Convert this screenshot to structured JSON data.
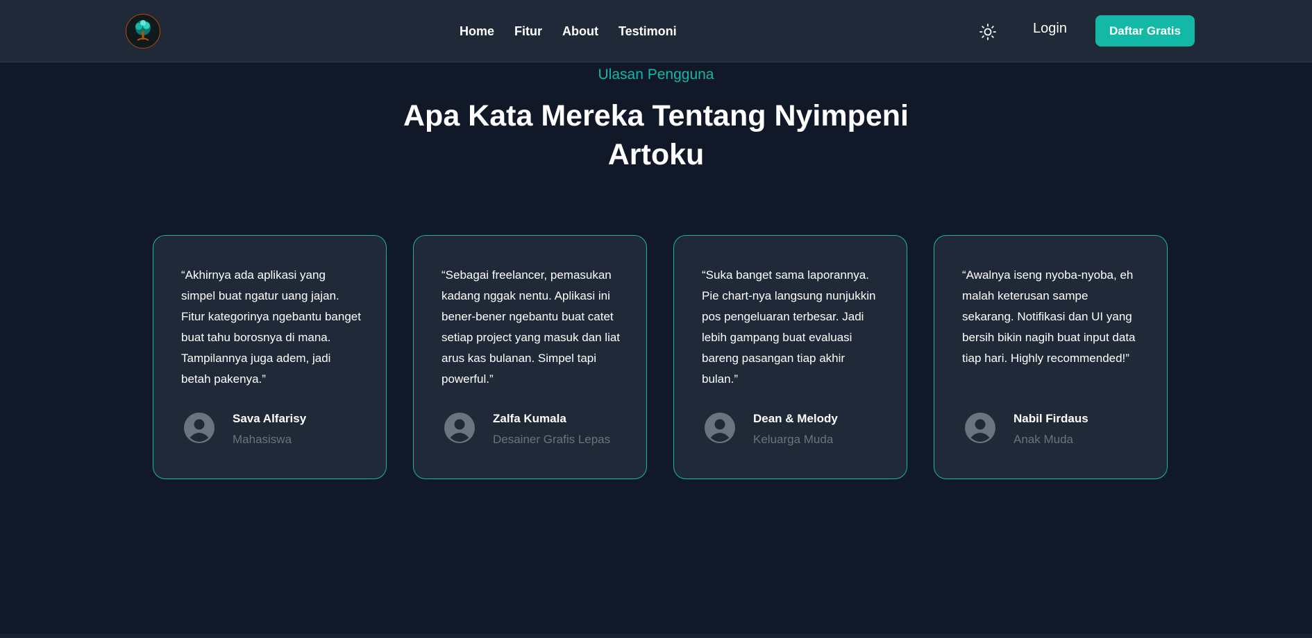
{
  "nav": {
    "links": [
      "Home",
      "Fitur",
      "About",
      "Testimoni"
    ],
    "login": "Login",
    "signup": "Daftar Gratis"
  },
  "section": {
    "eyebrow": "Ulasan Pengguna",
    "title": "Apa Kata Mereka Tentang Nyimpeni Artoku"
  },
  "testimonials": [
    {
      "quote": "“Akhirnya ada aplikasi yang simpel buat ngatur uang jajan. Fitur kategorinya ngebantu banget buat tahu borosnya di mana. Tampilannya juga adem, jadi betah pakenya.”",
      "name": "Sava Alfarisy",
      "role": "Mahasiswa"
    },
    {
      "quote": "“Sebagai freelancer, pemasukan kadang nggak nentu. Aplikasi ini bener-bener ngebantu buat catet setiap project yang masuk dan liat arus kas bulanan. Simpel tapi powerful.”",
      "name": "Zalfa Kumala",
      "role": "Desainer Grafis Lepas"
    },
    {
      "quote": "“Suka banget sama laporannya. Pie chart-nya langsung nunjukkin pos pengeluaran terbesar. Jadi lebih gampang buat evaluasi bareng pasangan tiap akhir bulan.”",
      "name": "Dean & Melody",
      "role": "Keluarga Muda"
    },
    {
      "quote": "“Awalnya iseng nyoba-nyoba, eh malah keterusan sampe sekarang. Notifikasi dan UI yang bersih bikin nagih buat input data tiap hari. Highly recommended!”",
      "name": "Nabil Firdaus",
      "role": "Anak Muda"
    }
  ],
  "colors": {
    "accent": "#14b8a6",
    "background": "#111827",
    "surface": "#1f2937",
    "muted": "#6b7280"
  },
  "icons": {
    "logo": "tree-logo-icon",
    "theme": "sun-icon",
    "avatar": "user-avatar-icon"
  }
}
